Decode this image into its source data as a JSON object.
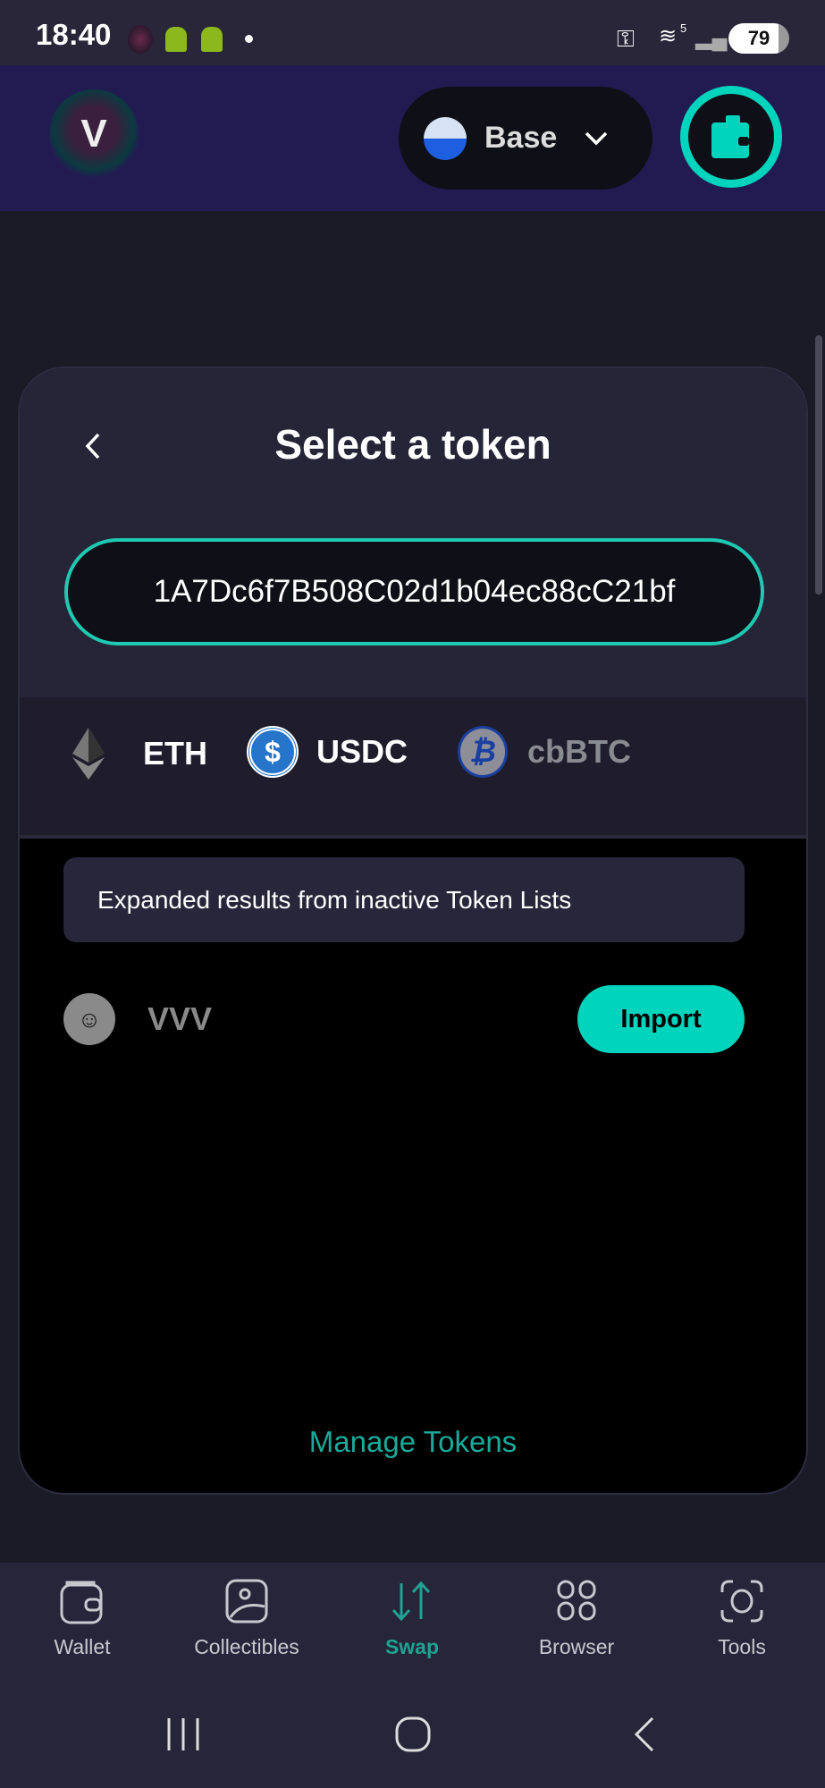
{
  "status_bar": {
    "time": "18:40",
    "battery": "79",
    "wifi_badge": "5"
  },
  "header": {
    "network": "Base",
    "network_icon": "base-logo",
    "wallet_icon": "wallet-icon"
  },
  "modal": {
    "title": "Select a token",
    "search_value": "1A7Dc6f7B508C02d1b04ec88cC21bf",
    "common_tokens": [
      {
        "symbol": "ETH"
      },
      {
        "symbol": "USDC"
      },
      {
        "symbol": "cbBTC"
      }
    ],
    "notice": "Expanded results from inactive Token Lists",
    "results": [
      {
        "symbol": "VVV",
        "action": "Import"
      }
    ],
    "manage_tokens": "Manage Tokens"
  },
  "bottom_nav": {
    "items": [
      {
        "label": "Wallet"
      },
      {
        "label": "Collectibles"
      },
      {
        "label": "Swap",
        "active": true
      },
      {
        "label": "Browser"
      },
      {
        "label": "Tools"
      }
    ]
  },
  "colors": {
    "accent": "#00d4bd",
    "header_bg": "#221b52",
    "active_tab": "#1fa391"
  }
}
